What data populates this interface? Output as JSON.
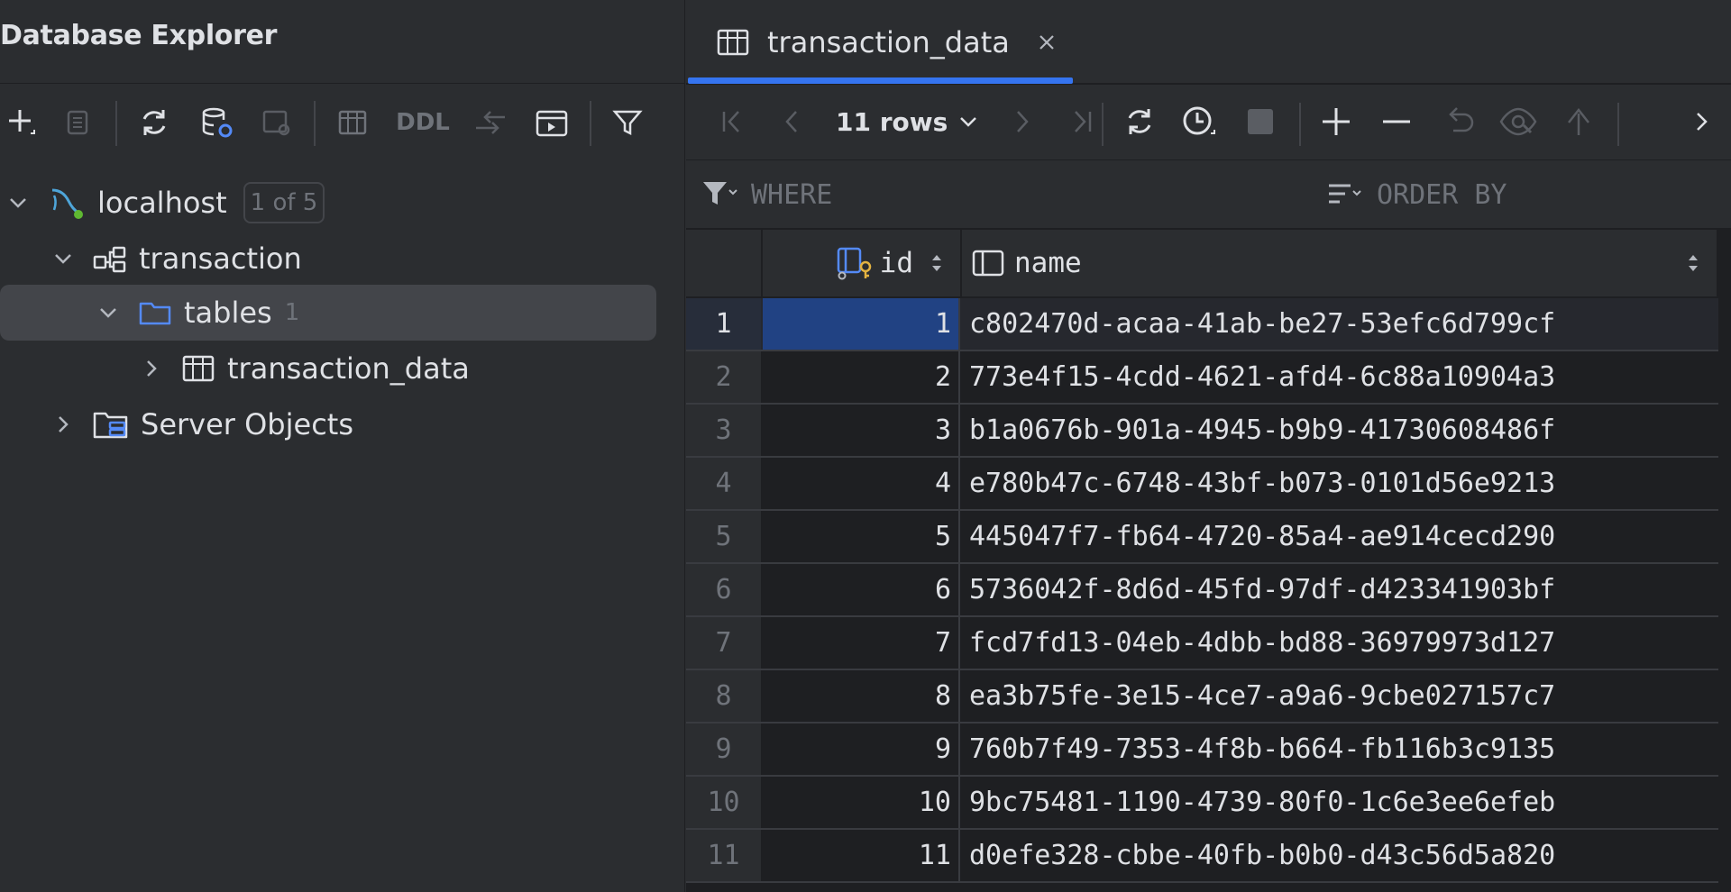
{
  "left_panel": {
    "title": "Database Explorer",
    "toolbar": {
      "ddl_label": "DDL"
    },
    "tree": {
      "connection": {
        "label": "localhost",
        "badge": "1 of 5"
      },
      "schema": {
        "label": "transaction"
      },
      "tables_folder": {
        "label": "tables",
        "count": "1"
      },
      "table": {
        "label": "transaction_data"
      },
      "server_objects": {
        "label": "Server Objects"
      }
    }
  },
  "editor": {
    "tab": {
      "label": "transaction_data"
    },
    "toolbar": {
      "rows_label": "11 rows"
    },
    "filter": {
      "where_label": "WHERE",
      "order_label": "ORDER BY"
    },
    "table": {
      "columns": [
        "id",
        "name"
      ],
      "rows": [
        {
          "n": "1",
          "id": "1",
          "name": "c802470d-acaa-41ab-be27-53efc6d799cf"
        },
        {
          "n": "2",
          "id": "2",
          "name": "773e4f15-4cdd-4621-afd4-6c88a10904a3"
        },
        {
          "n": "3",
          "id": "3",
          "name": "b1a0676b-901a-4945-b9b9-41730608486f"
        },
        {
          "n": "4",
          "id": "4",
          "name": "e780b47c-6748-43bf-b073-0101d56e9213"
        },
        {
          "n": "5",
          "id": "5",
          "name": "445047f7-fb64-4720-85a4-ae914cecd290"
        },
        {
          "n": "6",
          "id": "6",
          "name": "5736042f-8d6d-45fd-97df-d423341903bf"
        },
        {
          "n": "7",
          "id": "7",
          "name": "fcd7fd13-04eb-4dbb-bd88-36979973d127"
        },
        {
          "n": "8",
          "id": "8",
          "name": "ea3b75fe-3e15-4ce7-a9a6-9cbe027157c7"
        },
        {
          "n": "9",
          "id": "9",
          "name": "760b7f49-7353-4f8b-b664-fb116b3c9135"
        },
        {
          "n": "10",
          "id": "10",
          "name": "9bc75481-1190-4739-80f0-1c6e3ee6efeb"
        },
        {
          "n": "11",
          "id": "11",
          "name": "d0efe328-cbbe-40fb-b0b0-d43c56d5a820"
        }
      ]
    }
  },
  "colors": {
    "accent": "#3574f0",
    "selection": "#214283",
    "panel_bg": "#2b2d30",
    "editor_bg": "#1e1f22"
  }
}
